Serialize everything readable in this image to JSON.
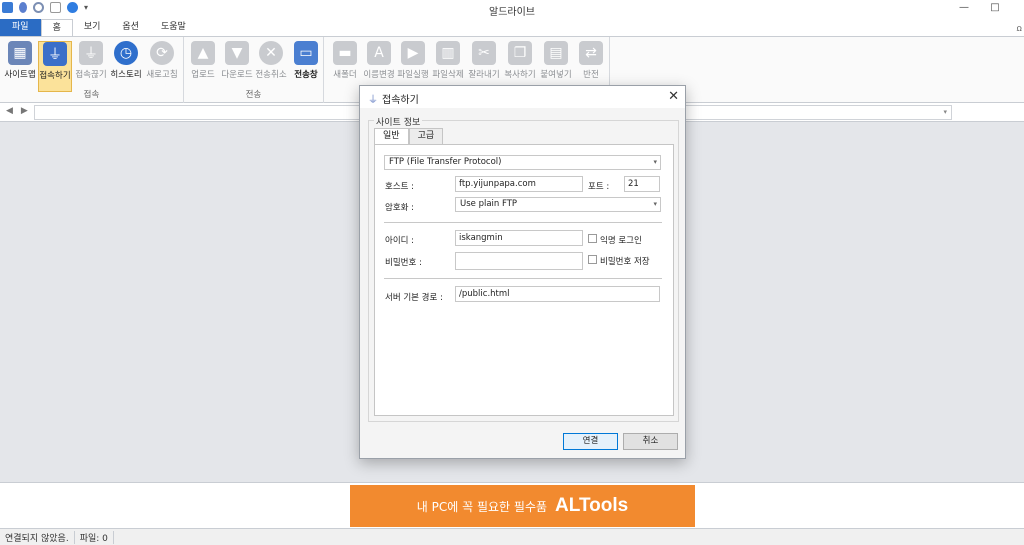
{
  "app": {
    "title": "알드라이브"
  },
  "tabs": [
    "파일",
    "홈",
    "보기",
    "옵션",
    "도움말"
  ],
  "ribbon": {
    "groups": [
      {
        "label": "접속",
        "buttons": [
          "사이트맵",
          "접속하기",
          "접속끊기",
          "히스토리",
          "새로고침"
        ]
      },
      {
        "label": "전송",
        "buttons": [
          "업로드",
          "다운로드",
          "전송취소",
          "전송창"
        ]
      },
      {
        "label": "",
        "buttons": [
          "새폴더",
          "이름변경",
          "파일실행",
          "파일삭제",
          "잘라내기",
          "복사하기",
          "붙여넣기",
          "반전"
        ]
      }
    ]
  },
  "colors": {
    "file_tab": "#2b6cc4",
    "banner": "#f28a2f",
    "accent": "#0078d7"
  },
  "dialog": {
    "title": "접속하기",
    "legend": "사이트 정보",
    "tabs": [
      "일반",
      "고급"
    ],
    "protocol": "FTP (File Transfer Protocol)",
    "host_label": "호스트 :",
    "host_value": "ftp.yijunpapa.com",
    "port_label": "포트 :",
    "port_value": "21",
    "encryption_label": "암호화 :",
    "encryption_value": "Use plain FTP",
    "id_label": "아이디 :",
    "id_value": "iskangmin",
    "anonymous_label": "익명 로그인",
    "password_label": "비밀번호 :",
    "password_value": "",
    "save_password_label": "비밀번호 저장",
    "path_label": "서버 기본 경로 :",
    "path_value": "/public.html",
    "connect_button": "연결",
    "cancel_button": "취소"
  },
  "banner": {
    "text": "내 PC에 꼭 필요한 필수품",
    "brand": "ALTools"
  },
  "status": {
    "connection": "연결되지 않았음.",
    "files": "파일: 0"
  }
}
